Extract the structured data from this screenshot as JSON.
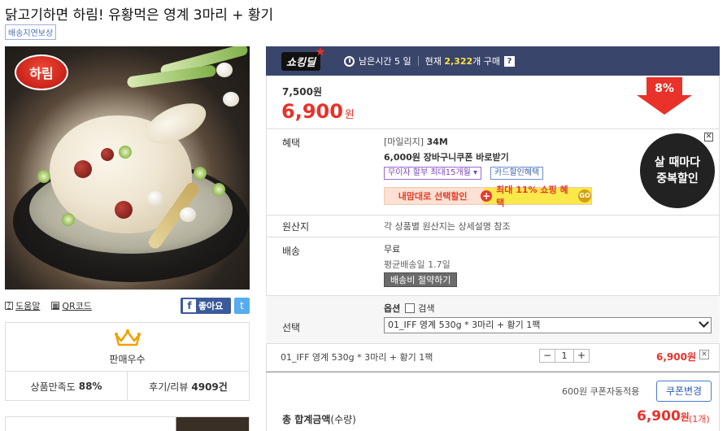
{
  "product": {
    "title": "닭고기하면 하림! 유황먹은 영계 3마리 + 황기",
    "delay_badge": "배송지연보상",
    "logo_text": "하림"
  },
  "util": {
    "help_label": "도움말",
    "qr_label": "QR코드",
    "like_label": "좋아요",
    "fb_glyph": "f",
    "tw_glyph": "t"
  },
  "award": {
    "label": "판매우수",
    "satisfaction_label": "상품만족도",
    "satisfaction_value": "88%",
    "review_label": "후기/리뷰",
    "review_value": "4909건"
  },
  "deal": {
    "logo": "쇼킹딜",
    "time_left": "남은시간 5 일",
    "current_label": "현재",
    "current_count": "2,322",
    "current_suffix": "개 구매",
    "help": "?"
  },
  "price": {
    "original": "7,500원",
    "sale": "6,900",
    "won": "원",
    "discount": "8%"
  },
  "benefit": {
    "label": "혜택",
    "mileage_prefix": "[마일리지]",
    "mileage_value": "34M",
    "coupon": "6,000원 장바구니쿠폰 바로받기",
    "installment": "무이자 할부 최대15개월 ▾",
    "card": "카드할인혜택",
    "promo_left": "내맘대로 선택할인",
    "promo_right": "최대 11% 쇼핑 혜택",
    "promo_go": "GO",
    "plus": "+"
  },
  "circle_ad": {
    "line1": "살 때마다",
    "line2": "중복할인",
    "close": "✕"
  },
  "origin": {
    "label": "원산지",
    "value": "각 상품별 원산지는 상세설명 참조"
  },
  "shipping": {
    "label": "배송",
    "fee": "무료",
    "avg": "평균배송일 1.7일",
    "btn": "배송비 절약하기"
  },
  "option": {
    "label": "선택",
    "title": "옵션",
    "search": "검색",
    "selected": "01_IFF 영계 530g * 3마리 + 황기 1팩"
  },
  "selection": {
    "name": "01_IFF 영계 530g * 3마리 + 황기 1팩",
    "minus": "−",
    "qty": "1",
    "plus": "+",
    "price": "6,900원",
    "remove": "✕"
  },
  "coupon": {
    "text": "600원 쿠폰자동적용",
    "btn": "쿠폰변경"
  },
  "total": {
    "label": "총 합계금액",
    "label_suffix": "(수량)",
    "price": "6,900",
    "won": "원",
    "count": "(1개)"
  },
  "colors": {
    "accent_red": "#e8322a",
    "deal_bar": "#3a456b",
    "count_yellow": "#ffe14a"
  }
}
